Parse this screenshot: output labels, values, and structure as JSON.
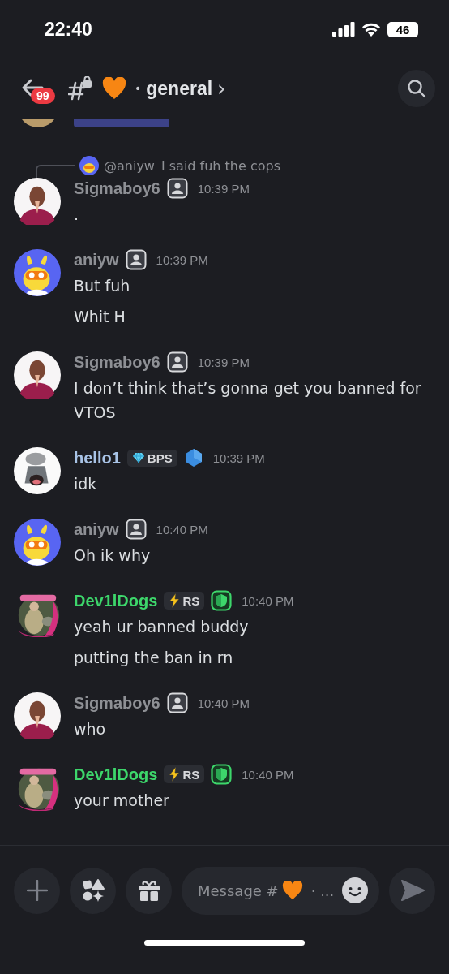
{
  "status_bar": {
    "time": "22:40",
    "battery": "46"
  },
  "header": {
    "unread_badge": "99",
    "separator": "•",
    "channel": "general",
    "chevron": "›"
  },
  "messages": [
    {
      "author": "Sigmaboy6",
      "color": "#8e9095",
      "avatar": {
        "kind": "figure"
      },
      "reply": {
        "author": "@aniyw",
        "text": "I said fuh the cops"
      },
      "role_icon": {
        "kind": "person"
      },
      "time": "10:39 PM",
      "lines": [
        "."
      ]
    },
    {
      "author": "aniyw",
      "color": "#8e9095",
      "avatar": {
        "kind": "bunny"
      },
      "role_icon": {
        "kind": "person"
      },
      "time": "10:39 PM",
      "lines": [
        "But fuh",
        "Whit H"
      ]
    },
    {
      "author": "Sigmaboy6",
      "color": "#8e9095",
      "avatar": {
        "kind": "figure"
      },
      "role_icon": {
        "kind": "person"
      },
      "time": "10:39 PM",
      "lines": [
        "I don’t think that’s gonna get you banned for VTOS"
      ]
    },
    {
      "author": "hello1",
      "color": "#a8c3e6",
      "avatar": {
        "kind": "shark"
      },
      "tag": {
        "kind": "diamond",
        "label": "BPS"
      },
      "role_icon": {
        "kind": "hexagon"
      },
      "time": "10:39 PM",
      "lines": [
        "idk"
      ]
    },
    {
      "author": "aniyw",
      "color": "#8e9095",
      "avatar": {
        "kind": "bunny"
      },
      "role_icon": {
        "kind": "person"
      },
      "time": "10:40 PM",
      "lines": [
        "Oh ik why"
      ]
    },
    {
      "author": "Dev1lDogs",
      "color": "#3dd66b",
      "avatar": {
        "kind": "photo"
      },
      "tag": {
        "kind": "bolt",
        "label": "RS"
      },
      "role_icon": {
        "kind": "shield"
      },
      "time": "10:40 PM",
      "lines": [
        "yeah ur banned buddy",
        "putting the ban in rn"
      ]
    },
    {
      "author": "Sigmaboy6",
      "color": "#8e9095",
      "avatar": {
        "kind": "figure"
      },
      "role_icon": {
        "kind": "person"
      },
      "time": "10:40 PM",
      "lines": [
        "who"
      ]
    },
    {
      "author": "Dev1lDogs",
      "color": "#3dd66b",
      "avatar": {
        "kind": "photo"
      },
      "tag": {
        "kind": "bolt",
        "label": "RS"
      },
      "role_icon": {
        "kind": "shield"
      },
      "time": "10:40 PM",
      "lines": [
        "your mother"
      ]
    }
  ],
  "composer": {
    "placeholder_start": "Message #",
    "placeholder_end": "· ..."
  }
}
